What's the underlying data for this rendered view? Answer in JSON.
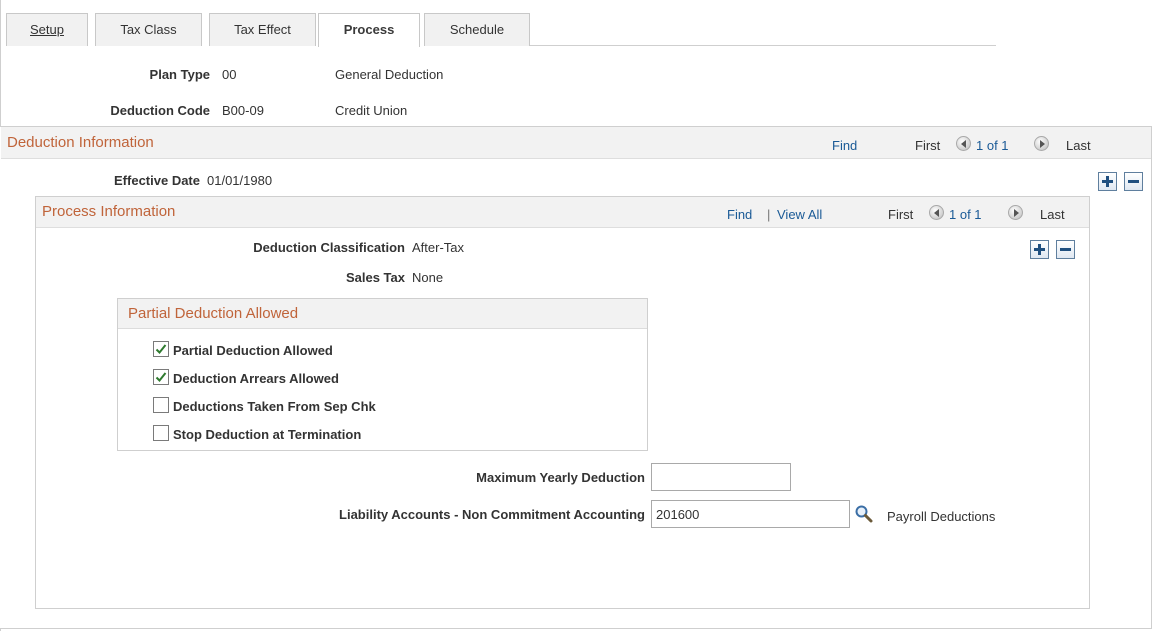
{
  "tabs": [
    {
      "label": "Setup",
      "active": false
    },
    {
      "label": "Tax Class",
      "active": false
    },
    {
      "label": "Tax Effect",
      "active": false
    },
    {
      "label": "Process",
      "active": true
    },
    {
      "label": "Schedule",
      "active": false
    }
  ],
  "header": {
    "plan_type_label": "Plan Type",
    "plan_type_code": "00",
    "plan_type_desc": "General Deduction",
    "deduction_code_label": "Deduction Code",
    "deduction_code": "B00-09",
    "deduction_code_desc": "Credit Union"
  },
  "deduction_info": {
    "title": "Deduction Information",
    "find": "Find",
    "first": "First",
    "count": "1 of 1",
    "last": "Last",
    "effective_date_label": "Effective Date",
    "effective_date": "01/01/1980"
  },
  "process_info": {
    "title": "Process Information",
    "find": "Find",
    "separator": "|",
    "view_all": "View All",
    "first": "First",
    "count": "1 of 1",
    "last": "Last",
    "classification_label": "Deduction Classification",
    "classification": "After-Tax",
    "sales_tax_label": "Sales Tax",
    "sales_tax": "None"
  },
  "partial": {
    "title": "Partial Deduction Allowed",
    "checkboxes": [
      {
        "label": "Partial Deduction Allowed",
        "checked": true
      },
      {
        "label": "Deduction Arrears Allowed",
        "checked": true
      },
      {
        "label": "Deductions Taken From Sep Chk",
        "checked": false
      },
      {
        "label": "Stop Deduction at Termination",
        "checked": false
      }
    ]
  },
  "fields": {
    "max_yearly_label": "Maximum Yearly Deduction",
    "max_yearly_value": "",
    "liability_label": "Liability Accounts - Non Commitment Accounting",
    "liability_value": "201600",
    "liability_desc": "Payroll Deductions"
  },
  "colors": {
    "section_title": "#c0643a",
    "link": "#1a5a96",
    "header_bg": "#f2f2f2",
    "check": "#2f7a2f"
  }
}
